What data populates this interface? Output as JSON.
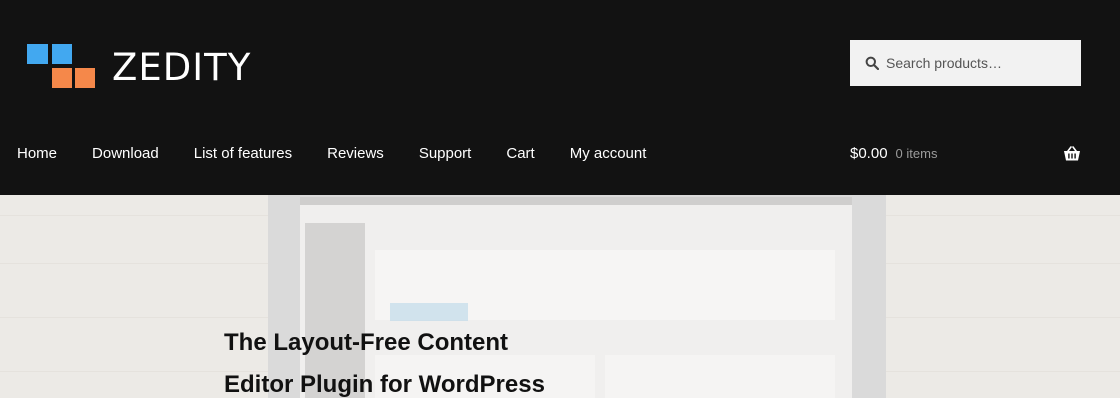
{
  "header": {
    "logo_text": "ZEDITY",
    "logo_colors": {
      "blue": "#42a8f0",
      "orange": "#f5884a"
    },
    "background": "#121212"
  },
  "search": {
    "placeholder": "Search products…",
    "icon": "search-icon"
  },
  "nav": {
    "items": [
      {
        "label": "Home"
      },
      {
        "label": "Download"
      },
      {
        "label": "List of features"
      },
      {
        "label": "Reviews"
      },
      {
        "label": "Support"
      },
      {
        "label": "Cart"
      },
      {
        "label": "My account"
      }
    ]
  },
  "cart": {
    "amount": "$0.00",
    "count": "0 items",
    "icon": "basket-icon"
  },
  "hero": {
    "headline_line1": "The Layout-Free Content",
    "headline_line2": "Editor Plugin for WordPress"
  }
}
